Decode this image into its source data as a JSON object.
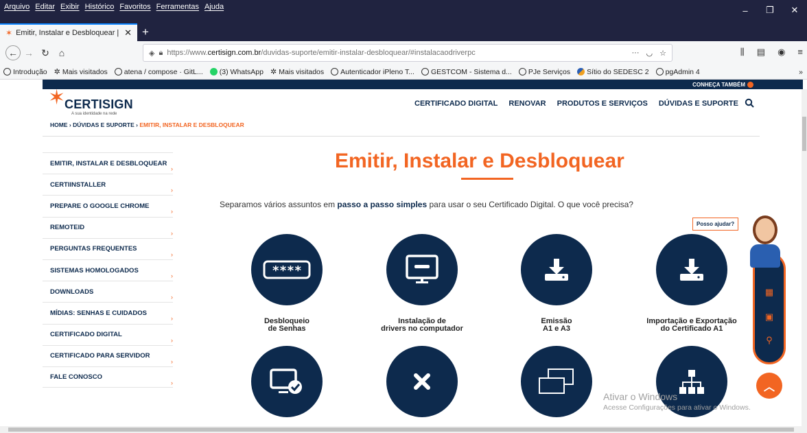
{
  "browser": {
    "menus": [
      "Arquivo",
      "Editar",
      "Exibir",
      "Histórico",
      "Favoritos",
      "Ferramentas",
      "Ajuda"
    ],
    "tab_title": "Emitir, Instalar e Desbloquear |",
    "url_prefix": "https://www.",
    "url_domain": "certisign.com.br",
    "url_path": "/duvidas-suporte/emitir-instalar-desbloquear/#instalacaodriverpc",
    "bookmarks": [
      "Introdução",
      "Mais visitados",
      "atena / compose · GitL...",
      "(3) WhatsApp",
      "Mais visitados",
      "Autenticador iPleno T...",
      "GESTCOM - Sistema d...",
      "PJe Serviços",
      "Sítio do SEDESC 2",
      "pgAdmin 4"
    ]
  },
  "site": {
    "conheca": "CONHEÇA TAMBÉM",
    "logo_name": "CERTISIGN",
    "logo_tag": "A sua identidade na rede",
    "nav": [
      "CERTIFICADO DIGITAL",
      "RENOVAR",
      "PRODUTOS E SERVIÇOS",
      "DÚVIDAS E SUPORTE"
    ],
    "breadcrumb": {
      "home": "HOME",
      "section": "DÚVIDAS E SUPORTE",
      "current": "EMITIR, INSTALAR E DESBLOQUEAR"
    }
  },
  "sidebar": {
    "items": [
      "EMITIR, INSTALAR E DESBLOQUEAR",
      "CERTIINSTALLER",
      "PREPARE O GOOGLE CHROME",
      "REMOTEID",
      "PERGUNTAS FREQUENTES",
      "SISTEMAS HOMOLOGADOS",
      "DOWNLOADS",
      "MÍDIAS: SENHAS E CUIDADOS",
      "CERTIFICADO DIGITAL",
      "CERTIFICADO PARA SERVIDOR",
      "FALE CONOSCO"
    ]
  },
  "main": {
    "title": "Emitir, Instalar e Desbloquear",
    "intro_before": "Separamos vários assuntos em ",
    "intro_bold": "passo a passo simples",
    "intro_after": " para usar o seu Certificado Digital. O que você precisa?",
    "cards": [
      {
        "label": "Desbloqueio\nde Senhas",
        "icon": "password-icon"
      },
      {
        "label": "Instalação de\ndrivers no computador",
        "icon": "computer-icon"
      },
      {
        "label": "Emissão\nA1 e A3",
        "icon": "download-icon"
      },
      {
        "label": "Importação e Exportação\ndo Certificado A1",
        "icon": "download-icon"
      },
      {
        "label": "",
        "icon": "monitor-check-icon"
      },
      {
        "label": "",
        "icon": "close-icon"
      },
      {
        "label": "",
        "icon": "windows-icon"
      },
      {
        "label": "",
        "icon": "sitemap-icon"
      }
    ]
  },
  "helper": {
    "text": "Posso ajudar?"
  },
  "watermark": {
    "line1": "Ativar o Windows",
    "line2": "Acesse Configurações para ativar o Windows."
  }
}
